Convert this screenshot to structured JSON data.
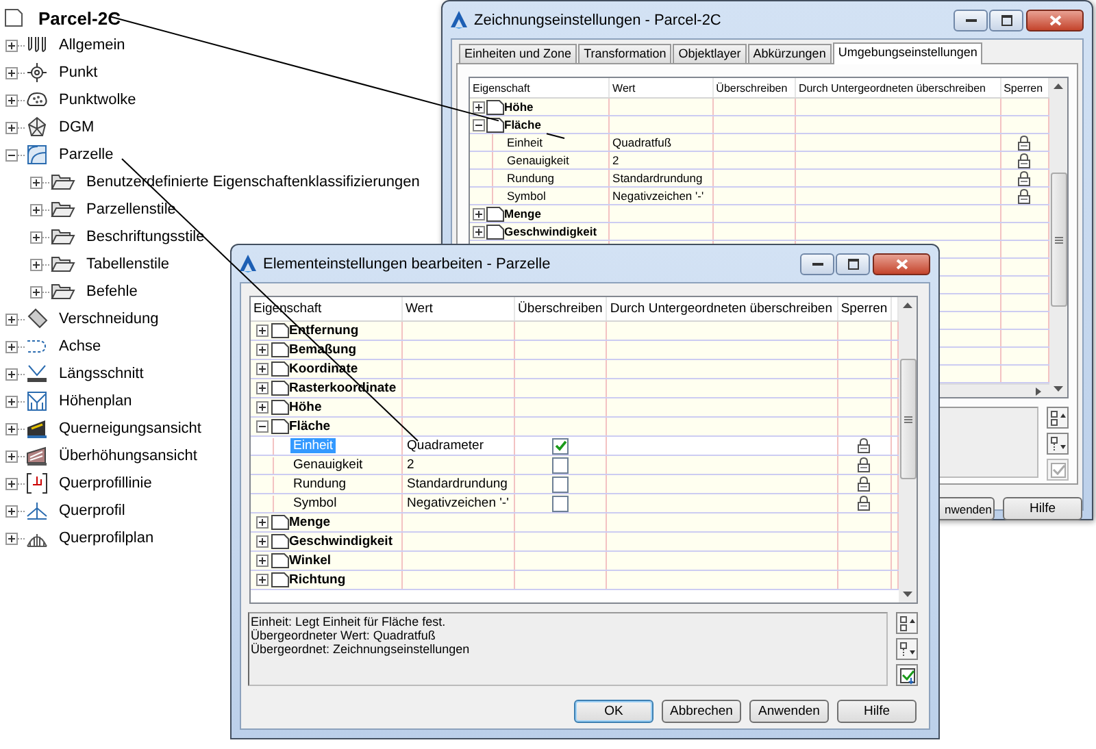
{
  "tree": {
    "root": "Parcel-2C",
    "items": [
      {
        "label": "Allgemein",
        "expanded": false
      },
      {
        "label": "Punkt",
        "expanded": false
      },
      {
        "label": "Punktwolke",
        "expanded": false
      },
      {
        "label": "DGM",
        "expanded": false
      },
      {
        "label": "Parzelle",
        "expanded": true,
        "children": [
          {
            "label": "Benutzerdefinierte Eigenschaftenklassifizierungen",
            "expanded": false
          },
          {
            "label": "Parzellenstile",
            "expanded": false
          },
          {
            "label": "Beschriftungsstile",
            "expanded": false
          },
          {
            "label": "Tabellenstile",
            "expanded": false
          },
          {
            "label": "Befehle",
            "expanded": false
          }
        ]
      },
      {
        "label": "Verschneidung",
        "expanded": false
      },
      {
        "label": "Achse",
        "expanded": false
      },
      {
        "label": "Längsschnitt",
        "expanded": false
      },
      {
        "label": "Höhenplan",
        "expanded": false
      },
      {
        "label": "Querneigungsansicht",
        "expanded": false
      },
      {
        "label": "Überhöhungsansicht",
        "expanded": false
      },
      {
        "label": "Querprofillinie",
        "expanded": false
      },
      {
        "label": "Querprofil",
        "expanded": false
      },
      {
        "label": "Querprofilplan",
        "expanded": false
      }
    ]
  },
  "drawing_settings": {
    "title": "Zeichnungseinstellungen - Parcel-2C",
    "tabs": [
      {
        "label": "Einheiten und Zone",
        "selected": false
      },
      {
        "label": "Transformation",
        "selected": false
      },
      {
        "label": "Objektlayer",
        "selected": false
      },
      {
        "label": "Abkürzungen",
        "selected": false
      },
      {
        "label": "Umgebungseinstellungen",
        "selected": true
      }
    ],
    "columns": [
      "Eigenschaft",
      "Wert",
      "Überschreiben",
      "Durch Untergeordneten überschreiben",
      "Sperren"
    ],
    "rows": [
      {
        "label": "Höhe",
        "expanded": false
      },
      {
        "label": "Fläche",
        "expanded": true,
        "children": [
          {
            "label": "Einheit",
            "value": "Quadratfuß"
          },
          {
            "label": "Genauigkeit",
            "value": "2"
          },
          {
            "label": "Rundung",
            "value": "Standardrundung"
          },
          {
            "label": "Symbol",
            "value": "Negativzeichen '-'"
          }
        ]
      },
      {
        "label": "Menge",
        "expanded": false
      },
      {
        "label": "Geschwindigkeit",
        "expanded": false
      }
    ],
    "buttons": [
      "nwenden",
      "Hilfe"
    ]
  },
  "element_settings": {
    "title": "Elementeinstellungen bearbeiten - Parzelle",
    "columns": [
      "Eigenschaft",
      "Wert",
      "Überschreiben",
      "Durch Untergeordneten überschreiben",
      "Sperren"
    ],
    "rows": [
      {
        "label": "Entfernung",
        "expanded": false
      },
      {
        "label": "Bemaßung",
        "expanded": false
      },
      {
        "label": "Koordinate",
        "expanded": false
      },
      {
        "label": "Rasterkoordinate",
        "expanded": false
      },
      {
        "label": "Höhe",
        "expanded": false
      },
      {
        "label": "Fläche",
        "expanded": true,
        "children": [
          {
            "label": "Einheit",
            "value": "Quadrameter",
            "override": true,
            "selected": true
          },
          {
            "label": "Genauigkeit",
            "value": "2",
            "override": false,
            "selected": false
          },
          {
            "label": "Rundung",
            "value": "Standardrundung",
            "override": false,
            "selected": false
          },
          {
            "label": "Symbol",
            "value": "Negativzeichen '-'",
            "override": false,
            "selected": false
          }
        ]
      },
      {
        "label": "Menge",
        "expanded": false
      },
      {
        "label": "Geschwindigkeit",
        "expanded": false
      },
      {
        "label": "Winkel",
        "expanded": false
      },
      {
        "label": "Richtung",
        "expanded": false
      }
    ],
    "description": [
      "Einheit: Legt Einheit für Fläche fest.",
      "Übergeordneter Wert: Quadratfuß",
      "Übergeordnet: Zeichnungseinstellungen"
    ],
    "buttons": [
      {
        "label": "OK",
        "default": true
      },
      {
        "label": "Abbrechen",
        "default": false
      },
      {
        "label": "Anwenden",
        "default": false
      },
      {
        "label": "Hilfe",
        "default": false
      }
    ]
  }
}
